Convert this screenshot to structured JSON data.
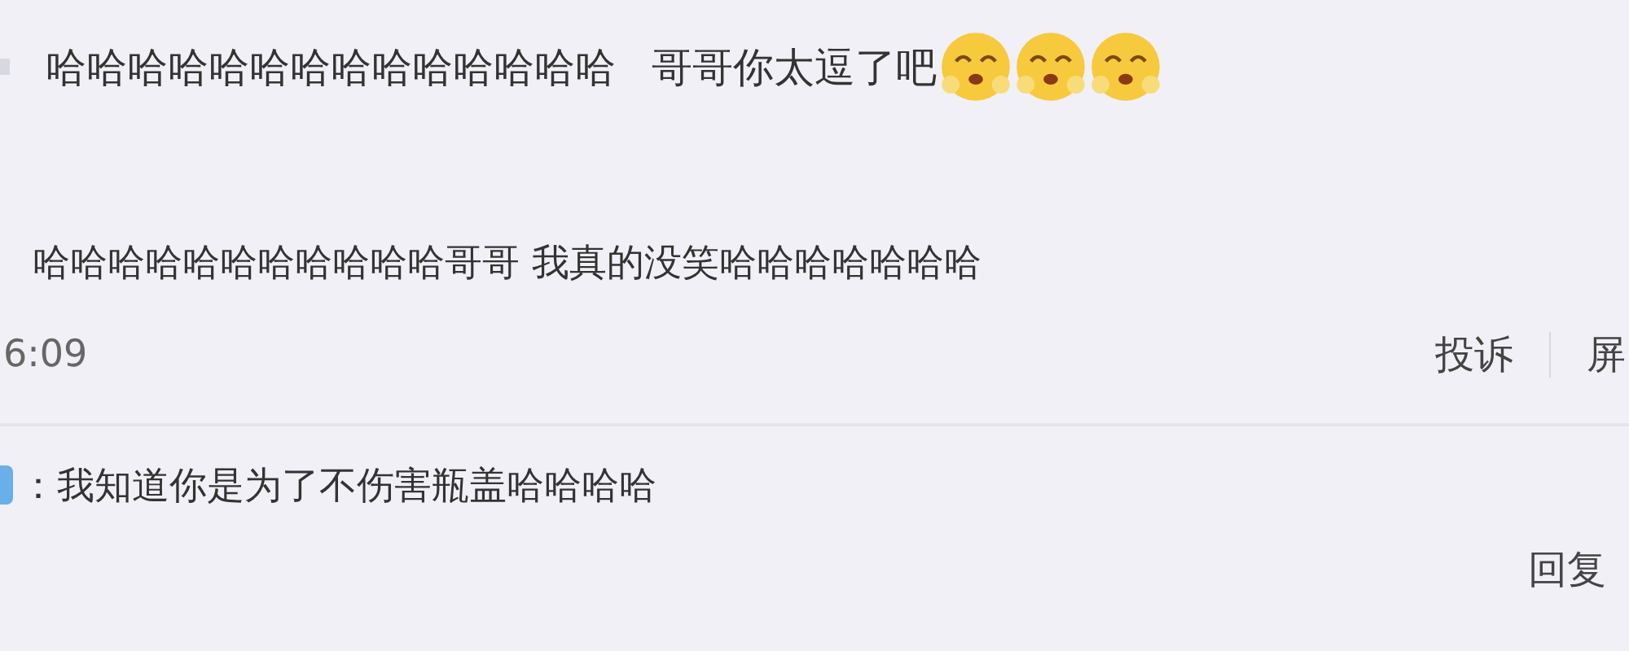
{
  "comments": [
    {
      "text": "哈哈哈哈哈哈哈哈哈哈哈哈哈哈",
      "suffix": "哥哥你太逗了吧",
      "emojis": [
        {
          "kind": "smiley"
        },
        {
          "kind": "smiley"
        },
        {
          "kind": "smiley"
        }
      ]
    },
    {
      "text": "哈哈哈哈哈哈哈哈哈哈哈哥哥 我真的没笑哈哈哈哈哈哈哈",
      "time": "6:09",
      "actions": [
        "投诉",
        "屏"
      ]
    }
  ],
  "reply": {
    "separator": "：",
    "text": "我知道你是为了不伤害瓶盖哈哈哈哈",
    "action": "回复"
  }
}
